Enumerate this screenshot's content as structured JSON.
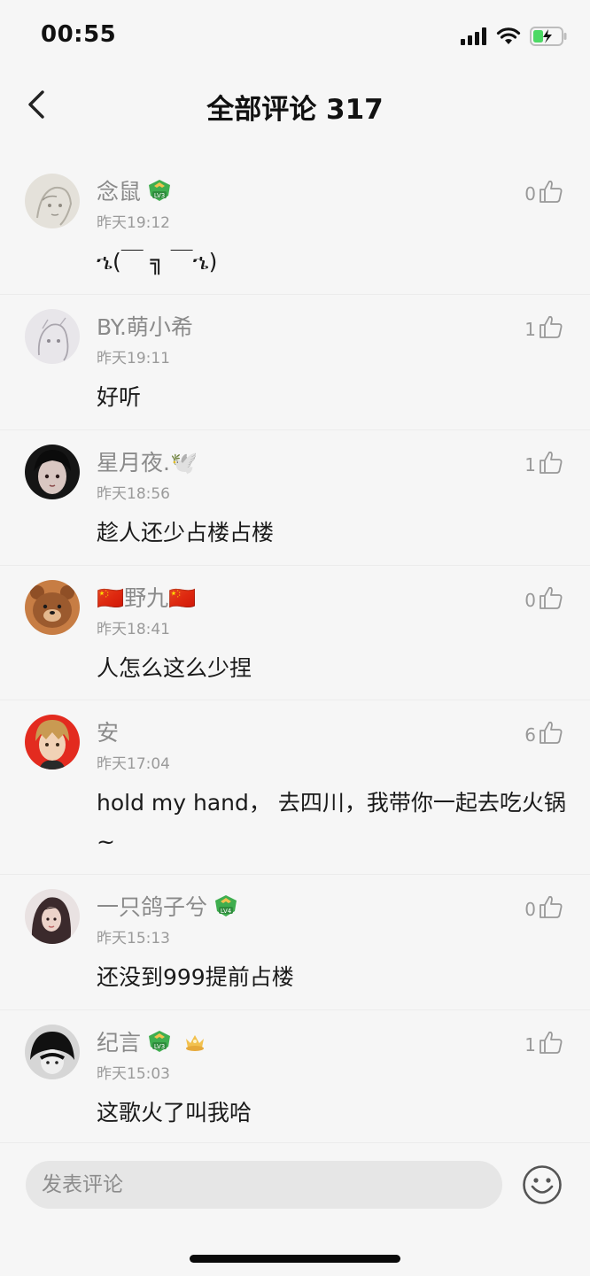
{
  "status_bar": {
    "time": "00:55"
  },
  "header": {
    "title": "全部评论 317"
  },
  "comments": [
    {
      "username": "念鼠",
      "time": "昨天19:12",
      "text": "ኄ(￣ ╗ ￣ኄ)",
      "likes": "0",
      "badge": "lv3"
    },
    {
      "username": "BY.萌小希",
      "time": "昨天19:11",
      "text": "好听",
      "likes": "1"
    },
    {
      "username": "星月夜.🕊️",
      "time": "昨天18:56",
      "text": "趁人还少占楼占楼",
      "likes": "1"
    },
    {
      "username": "🇨🇳野九🇨🇳",
      "time": "昨天18:41",
      "text": "人怎么这么少捏",
      "likes": "0"
    },
    {
      "username": "安",
      "time": "昨天17:04",
      "text": "hold my hand， 去四川，我带你一起去吃火锅~",
      "likes": "6"
    },
    {
      "username": "一只鸽子兮",
      "time": "昨天15:13",
      "text": "还没到999提前占楼",
      "likes": "0",
      "badge": "lv4"
    },
    {
      "username": "纪言",
      "time": "昨天15:03",
      "text": "这歌火了叫我哈",
      "likes": "1",
      "badge": "lv3"
    }
  ],
  "composer": {
    "placeholder": "发表评论"
  },
  "colors": {
    "badge_green": "#3fae4f",
    "badge_gold": "#f2c14e",
    "background": "#f6f6f6"
  }
}
